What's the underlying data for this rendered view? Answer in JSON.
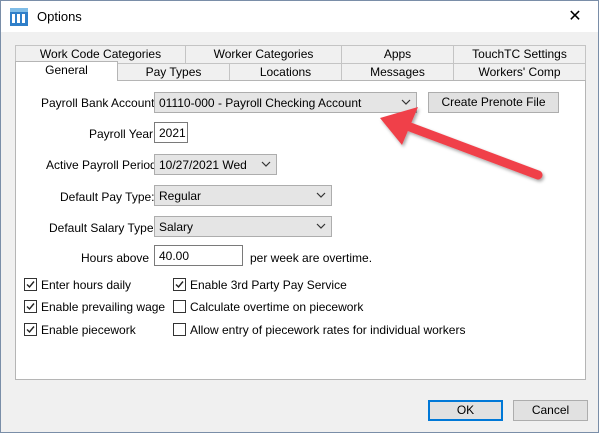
{
  "window": {
    "title": "Options",
    "close_glyph": "✕"
  },
  "tabs": {
    "back_row": [
      "Work Code Categories",
      "Worker Categories",
      "Apps",
      "TouchTC Settings"
    ],
    "front_row": [
      "General",
      "Pay Types",
      "Locations",
      "Messages",
      "Workers' Comp"
    ],
    "active": "General"
  },
  "general": {
    "payroll_bank_account": {
      "label": "Payroll Bank Account:",
      "value": "01110-000 - Payroll Checking Account"
    },
    "create_prenote_button": "Create Prenote File",
    "payroll_year": {
      "label": "Payroll Year:",
      "value": "2021"
    },
    "active_payroll_period": {
      "label": "Active Payroll Period:",
      "value": "10/27/2021 Wed"
    },
    "default_pay_type": {
      "label": "Default Pay Type:",
      "value": "Regular"
    },
    "default_salary_type": {
      "label": "Default Salary Type:",
      "value": "Salary"
    },
    "hours_above": {
      "label": "Hours above",
      "value": "40.00",
      "suffix": "per week are overtime."
    },
    "checkboxes_left": [
      {
        "label": "Enter hours daily",
        "checked": true
      },
      {
        "label": "Enable prevailing wage",
        "checked": true
      },
      {
        "label": "Enable piecework",
        "checked": true
      }
    ],
    "checkboxes_right": [
      {
        "label": "Enable 3rd Party Pay Service",
        "checked": true
      },
      {
        "label": "Calculate overtime on piecework",
        "checked": false
      },
      {
        "label": "Allow entry of piecework rates for individual workers",
        "checked": false
      }
    ]
  },
  "footer": {
    "ok": "OK",
    "cancel": "Cancel"
  },
  "colors": {
    "annotation_arrow": "#f0404a",
    "default_button_border": "#0078d7"
  },
  "icons": {
    "app": "options-app-icon",
    "dropdown": "chevron-down-icon",
    "check": "checkmark-icon"
  }
}
